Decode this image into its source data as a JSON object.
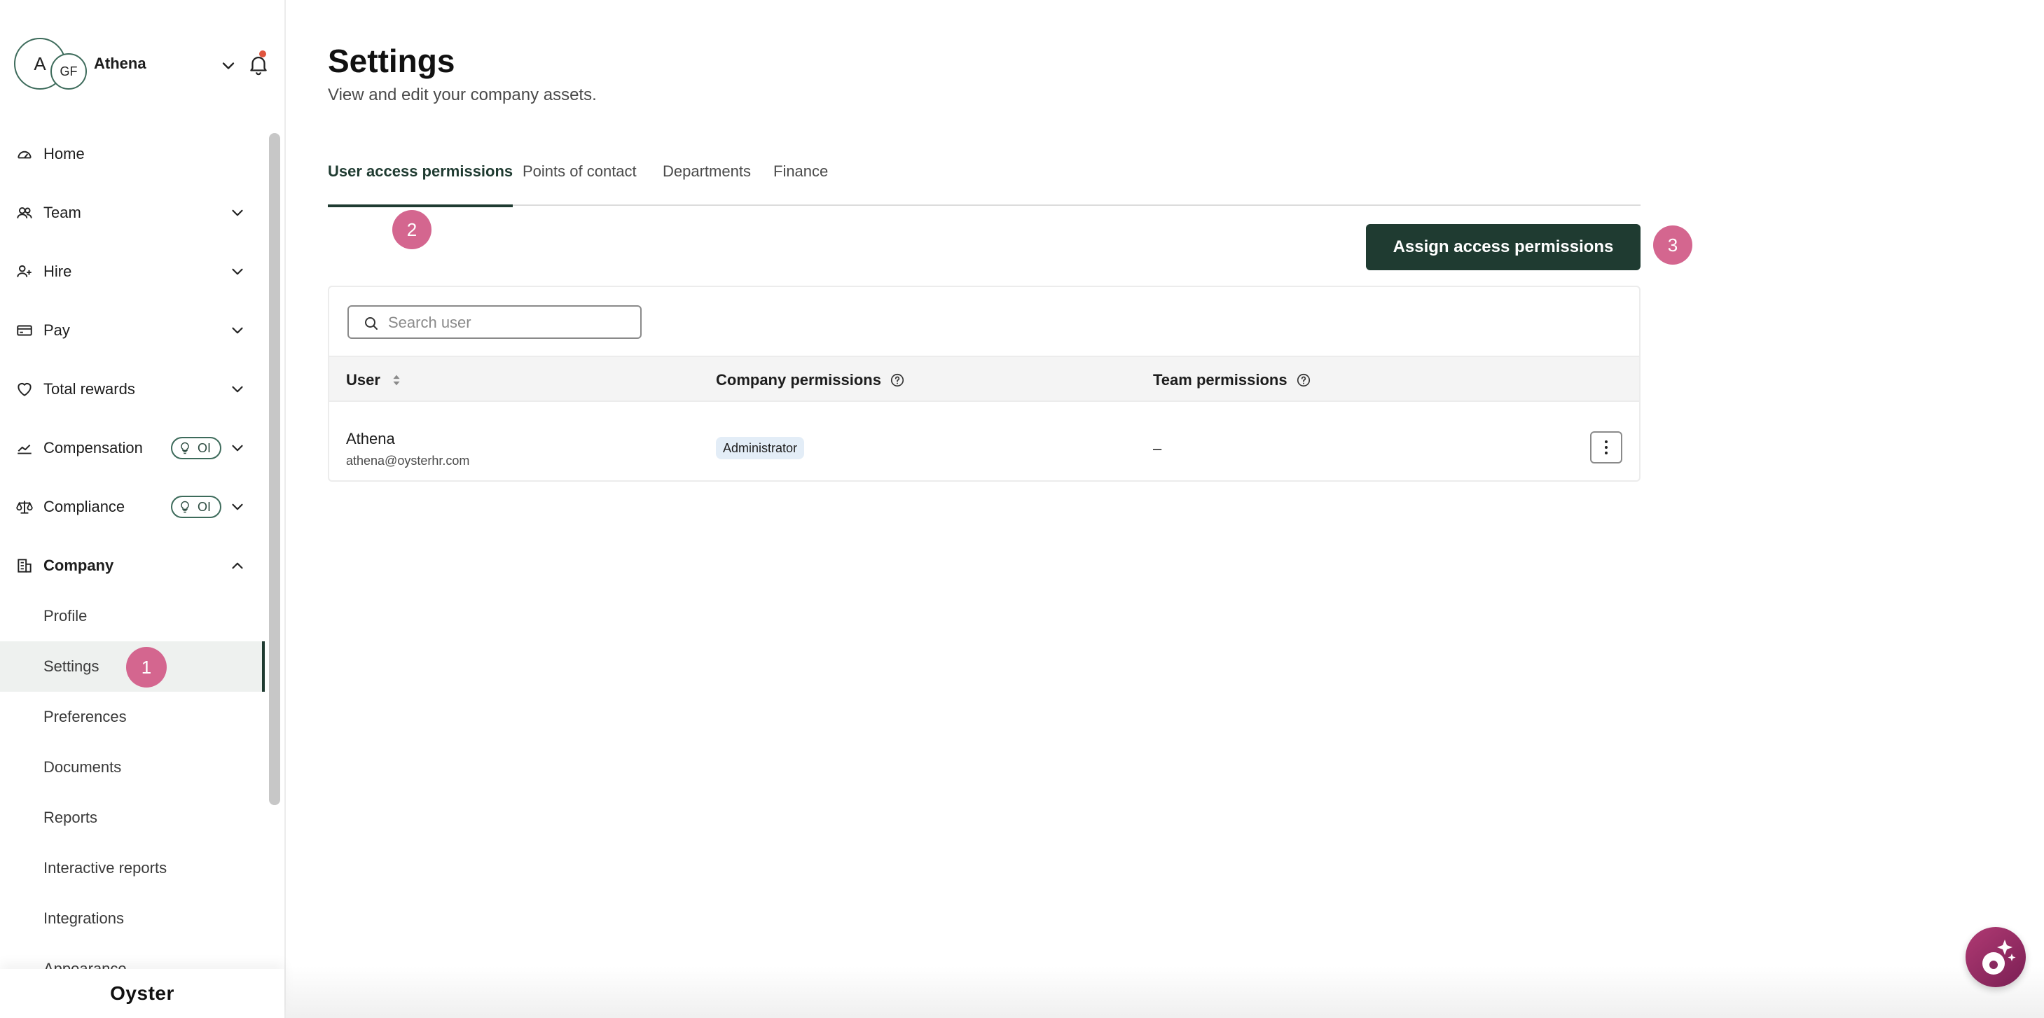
{
  "account": {
    "avatar_primary": "A",
    "avatar_secondary": "GF",
    "name": "Athena"
  },
  "sidebar": {
    "items": [
      {
        "label": "Home",
        "icon": "home-gauge-icon"
      },
      {
        "label": "Team",
        "icon": "team-icon"
      },
      {
        "label": "Hire",
        "icon": "user-plus-icon"
      },
      {
        "label": "Pay",
        "icon": "card-icon"
      },
      {
        "label": "Total rewards",
        "icon": "heart-icon"
      },
      {
        "label": "Compensation",
        "icon": "chart-icon",
        "badge": "OI"
      },
      {
        "label": "Compliance",
        "icon": "scale-icon",
        "badge": "OI"
      },
      {
        "label": "Company",
        "icon": "building-icon"
      }
    ],
    "company_subitems": [
      {
        "label": "Profile"
      },
      {
        "label": "Settings",
        "active": true
      },
      {
        "label": "Preferences"
      },
      {
        "label": "Documents"
      },
      {
        "label": "Reports"
      },
      {
        "label": "Interactive reports"
      },
      {
        "label": "Integrations"
      },
      {
        "label": "Appearance"
      }
    ],
    "footer_logo": "Oyster"
  },
  "page": {
    "title": "Settings",
    "subtitle": "View and edit your company assets."
  },
  "tabs": [
    {
      "label": "User access permissions",
      "active": true
    },
    {
      "label": "Points of contact"
    },
    {
      "label": "Departments"
    },
    {
      "label": "Finance"
    }
  ],
  "toolbar": {
    "assign_label": "Assign access permissions"
  },
  "search": {
    "placeholder": "Search user",
    "value": ""
  },
  "table": {
    "columns": [
      "User",
      "Company permissions",
      "Team permissions"
    ],
    "rows": [
      {
        "name": "Athena",
        "email": "athena@oysterhr.com",
        "company_permission": "Administrator",
        "team_permission": "–"
      }
    ]
  },
  "steps": [
    "1",
    "2",
    "3"
  ],
  "colors": {
    "brand_dark": "#1f3b31",
    "step_marker": "#d4668f",
    "badge_bg": "#e3edf7",
    "notification_dot": "#e0553f"
  }
}
